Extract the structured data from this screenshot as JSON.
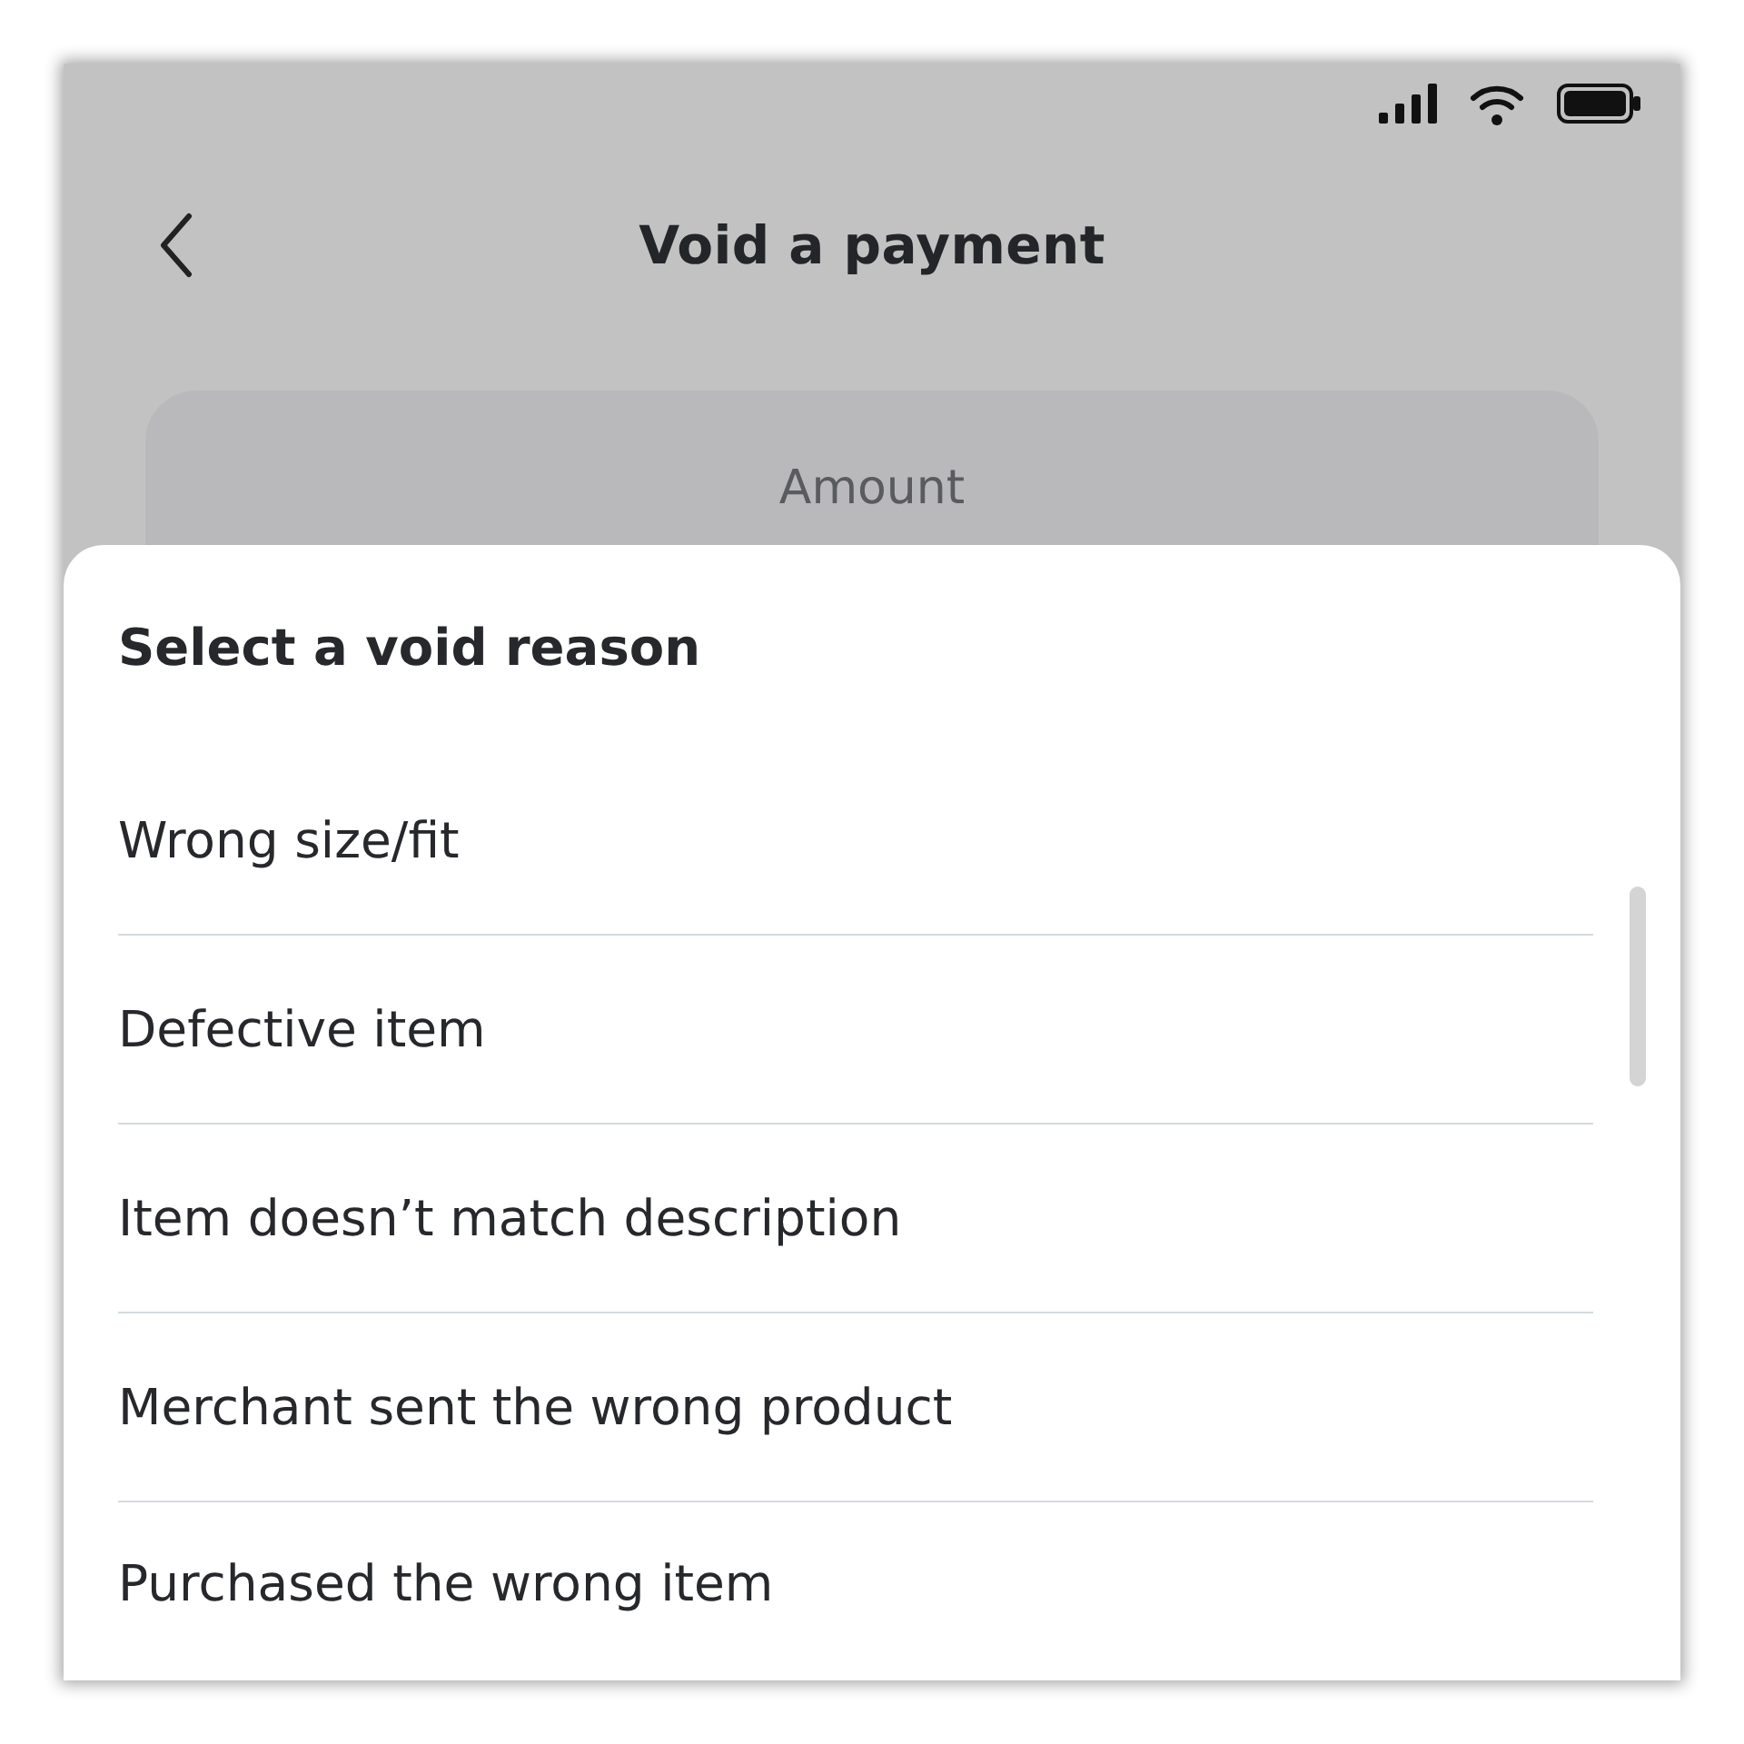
{
  "header": {
    "title": "Void a payment"
  },
  "amount_card": {
    "label": "Amount"
  },
  "sheet": {
    "title": "Select a void reason",
    "options": [
      {
        "label": "Wrong size/fit"
      },
      {
        "label": "Defective item"
      },
      {
        "label": "Item doesn’t match description"
      },
      {
        "label": "Merchant sent the wrong product"
      },
      {
        "label": "Purchased the wrong item"
      }
    ]
  }
}
